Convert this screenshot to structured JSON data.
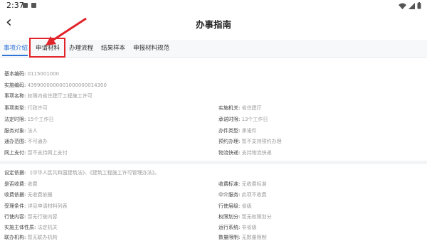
{
  "status": {
    "time": "2:37"
  },
  "header": {
    "title": "办事指南"
  },
  "tabs": [
    {
      "label": "事项介绍",
      "active": true
    },
    {
      "label": "申请材料",
      "active": false
    },
    {
      "label": "办理流程",
      "active": false
    },
    {
      "label": "结果样本",
      "active": false
    },
    {
      "label": "申报材料规范",
      "active": false
    }
  ],
  "basic": {
    "code_label": "基本编码:",
    "code": "0115001000",
    "impl_code_label": "实施编码:",
    "impl_code": "4399000000001000000014300",
    "name_label": "事项名称:",
    "name": "权限内省住建厅工程施工许可"
  },
  "left_list": [
    {
      "label": "事项类型:",
      "value": "行政许可"
    },
    {
      "label": "法定时限:",
      "value": "15个工作日"
    },
    {
      "label": "服务对象:",
      "value": "法人"
    },
    {
      "label": "通办范围:",
      "value": "不可通办"
    },
    {
      "label": "网上支付:",
      "value": "暂不支持网上支付"
    }
  ],
  "right_list": [
    {
      "label": "实施机关:",
      "value": "省住建厅"
    },
    {
      "label": "承诺时限:",
      "value": "13个工作日"
    },
    {
      "label": "办件类型:",
      "value": "承诺件"
    },
    {
      "label": "预约办理:",
      "value": "暂不支持预约办理"
    },
    {
      "label": "物流快递:",
      "value": "支持物流快递"
    }
  ],
  "basis": {
    "label": "设定依据:",
    "value": "《中华人民共和国建筑法》、《建筑工程施工许可管理办法》。"
  },
  "left_list2": [
    {
      "label": "是否收费:",
      "value": "收费"
    },
    {
      "label": "收费依据:",
      "value": "无收费依据"
    },
    {
      "label": "受理条件:",
      "value": "详见申请材料列表"
    },
    {
      "label": "行使内容:",
      "value": "暂无行驶内容"
    },
    {
      "label": "实施主体性质:",
      "value": "法定机关"
    },
    {
      "label": "联办机构:",
      "value": "暂无联办机构"
    }
  ],
  "right_list2": [
    {
      "label": "收费标准:",
      "value": "无收费标准"
    },
    {
      "label": "中介服务:",
      "value": "此项不收费"
    },
    {
      "label": "行使层级:",
      "value": "省级"
    },
    {
      "label": "权限划分:",
      "value": "暂无权限划分"
    },
    {
      "label": "运行系统:",
      "value": "非省级"
    },
    {
      "label": "数量限制:",
      "value": "无数量限制"
    }
  ],
  "colors": {
    "accent": "#2d74d6",
    "callout": "#e0242a"
  }
}
